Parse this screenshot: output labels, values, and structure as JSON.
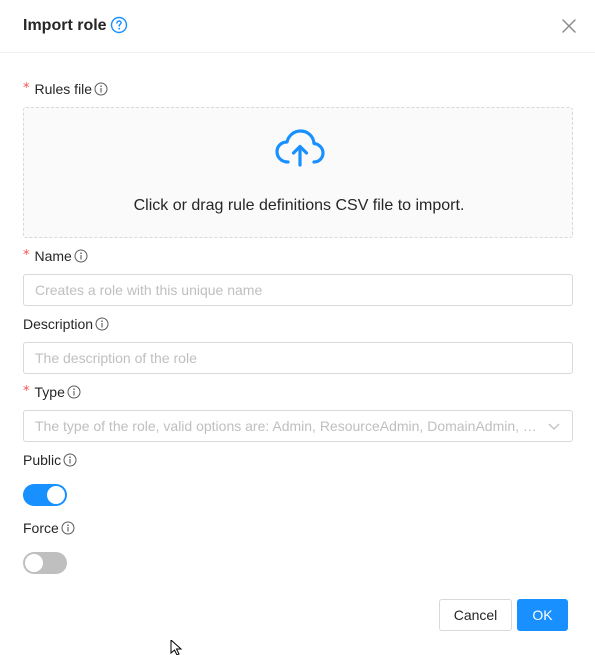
{
  "modal": {
    "title": "Import role",
    "icons": {
      "help": "question-circle-icon",
      "close": "close-icon",
      "info": "info-circle-icon",
      "upload": "cloud-upload-icon",
      "select": "chevron-down-icon"
    }
  },
  "form": {
    "rules_file": {
      "label": "Rules file",
      "required_mark": "*",
      "dropzone_text": "Click or drag rule definitions CSV file to import."
    },
    "name": {
      "label": "Name",
      "required_mark": "*",
      "placeholder": "Creates a role with this unique name"
    },
    "description": {
      "label": "Description",
      "placeholder": "The description of the role"
    },
    "type": {
      "label": "Type",
      "required_mark": "*",
      "placeholder": "The type of the role, valid options are: Admin, ResourceAdmin, DomainAdmin, U..."
    },
    "public": {
      "label": "Public",
      "checked": true
    },
    "force": {
      "label": "Force",
      "checked": false
    }
  },
  "footer": {
    "cancel_label": "Cancel",
    "ok_label": "OK"
  },
  "colors": {
    "primary": "#1890ff",
    "required": "#ff4d4f",
    "border": "#d9d9d9",
    "placeholder": "#bfbfbf"
  }
}
